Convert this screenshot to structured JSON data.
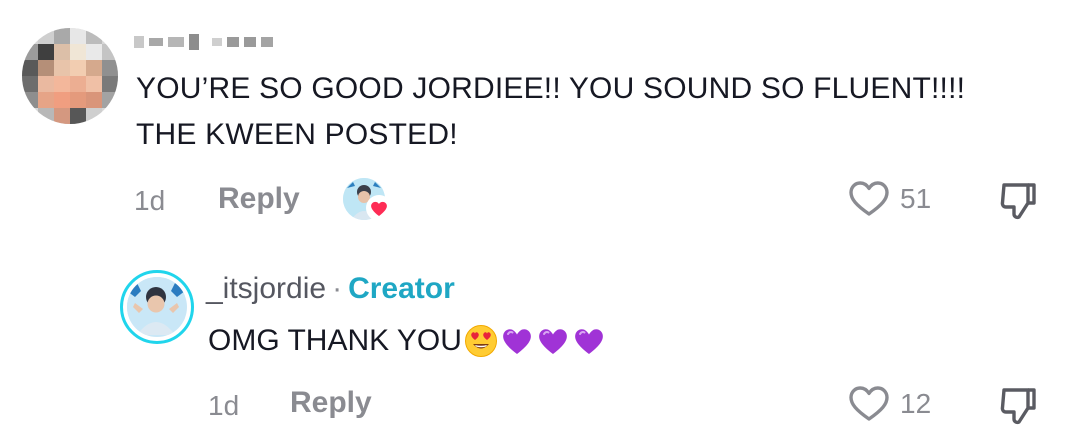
{
  "comment": {
    "author_obscured": "",
    "text_line1": "YOU’RE SO GOOD JORDIEE!! YOU SOUND SO FLUENT!!!!",
    "text_line2": "THE KWEEN POSTED!",
    "time": "1d",
    "reply_label": "Reply",
    "like_count": "51",
    "creator_liked": true
  },
  "reply": {
    "username": "_itsjordie",
    "separator": "·",
    "badge": "Creator",
    "text": "OMG THANK YOU",
    "emojis": [
      "smiling-face-with-heart-eyes",
      "purple-heart",
      "purple-heart",
      "purple-heart"
    ],
    "time": "1d",
    "reply_label": "Reply",
    "like_count": "12"
  },
  "colors": {
    "accent_creator": "#1fa7c4",
    "avatar_ring": "#20d5ec",
    "meta_gray": "#8a8b91",
    "heart_red": "#fe2c55",
    "purple_heart": "#a033d6"
  }
}
